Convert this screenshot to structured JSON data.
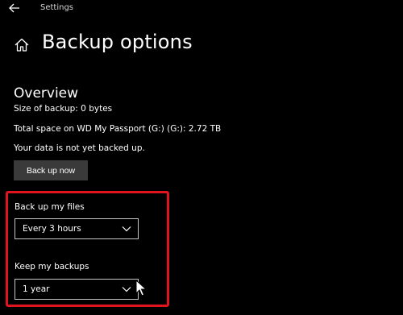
{
  "window": {
    "title": "Settings"
  },
  "header": {
    "page_title": "Backup options"
  },
  "overview": {
    "title": "Overview",
    "size_of_backup": "Size of backup: 0 bytes",
    "total_space": "Total space on WD My Passport (G:) (G:): 2.72 TB",
    "status": "Your data is not yet backed up.",
    "backup_now_label": "Back up now"
  },
  "settings": {
    "backup_files_label": "Back up my files",
    "backup_files_value": "Every 3 hours",
    "keep_backups_label": "Keep my backups",
    "keep_backups_value": "1 year"
  },
  "icons": {
    "back": "back-arrow-icon",
    "home": "home-icon",
    "chevron": "chevron-down-icon",
    "cursor": "mouse-pointer-icon"
  },
  "colors": {
    "background": "#000000",
    "button": "#3a3a3a",
    "highlight": "#e0141e",
    "dropdown_border": "#c8c8c8"
  }
}
